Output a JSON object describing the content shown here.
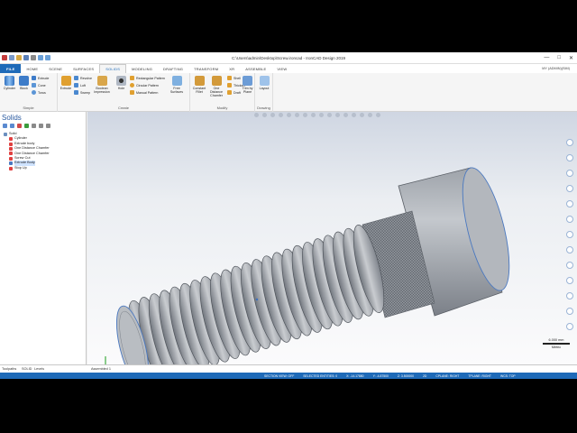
{
  "window": {
    "title": "C:\\Users\\admin\\Desktop\\Screw.ironcad - IronCAD Design 2019",
    "min": "—",
    "max": "□",
    "close": "✕"
  },
  "tabs": [
    {
      "label": "FILE",
      "kind": "file"
    },
    {
      "label": "HOME",
      "kind": ""
    },
    {
      "label": "SCENE",
      "kind": ""
    },
    {
      "label": "SURFACES",
      "kind": ""
    },
    {
      "label": "SOLIDS",
      "kind": "active"
    },
    {
      "label": "MODELING",
      "kind": ""
    },
    {
      "label": "DRAFTING",
      "kind": ""
    },
    {
      "label": "TRANSFORM",
      "kind": ""
    },
    {
      "label": "XR",
      "kind": ""
    },
    {
      "label": "ASSEMBLE",
      "kind": ""
    },
    {
      "label": "VIEW",
      "kind": ""
    }
  ],
  "user": "MY (ADMIN)(SIM)",
  "ribbon": {
    "groups": {
      "simple": "Simple",
      "create": "Create",
      "modify": "Modify",
      "drawing": "Drawing"
    },
    "buttons": {
      "cylinder": "Cylinder",
      "block": "Block",
      "extrude": "Extrude",
      "cone": "Cone",
      "torus": "Torus",
      "extrude2": "Extrude",
      "revolve": "Revolve",
      "loft": "Loft",
      "sweep": "Sweep",
      "boolean": "Boolean Impression",
      "hole": "Hole",
      "rect_pattern": "Rectangular Pattern",
      "circ_pattern": "Circular Pattern",
      "manual_pattern": "Manual Pattern",
      "free_surfaces": "Free Surfaces",
      "constant_fillet": "Constant Fillet",
      "one_distance_chamfer": "One Distance Chamfer",
      "shell": "Shell",
      "thicken": "Thicken",
      "draft": "Draft",
      "trim_by_plane": "Trim by Plane",
      "layout": "Layout"
    }
  },
  "panel": {
    "title": "Solids",
    "tree": [
      {
        "label": "Solid",
        "indent": 0,
        "color": "#6b8fbf",
        "selected": false
      },
      {
        "label": "Cylinder",
        "indent": 1,
        "color": "#e04040",
        "selected": false
      },
      {
        "label": "Extrude body",
        "indent": 1,
        "color": "#e04040",
        "selected": false
      },
      {
        "label": "One Distance Chamfer",
        "indent": 1,
        "color": "#e04040",
        "selected": false
      },
      {
        "label": "One Distance Chamfer",
        "indent": 1,
        "color": "#e04040",
        "selected": false
      },
      {
        "label": "Screw Cut",
        "indent": 1,
        "color": "#e04040",
        "selected": false
      },
      {
        "label": "Extrude Body",
        "indent": 1,
        "color": "#4a78c0",
        "selected": true
      },
      {
        "label": "Stop Up",
        "indent": 1,
        "color": "#e04040",
        "selected": false
      }
    ]
  },
  "scale": {
    "value": "6.000 mm",
    "unit": "Metric"
  },
  "docbar": {
    "tab1": "Toolpaths",
    "tab2": "SOLID",
    "tab3": "Levels",
    "doc": "Assembled 1"
  },
  "status": [
    "SECTION VIEW: OFF",
    "SELECTED ENTITIES: 0",
    "X: -14.17880",
    "Y: -4.87500",
    "Z: 3.500000",
    "2D",
    "CPLANE: RIGHT",
    "TPLANE: RIGHT",
    "WCS: TOP"
  ],
  "colors": {
    "accent": "#1e6ab8",
    "status_bar": "#1e6ab8"
  }
}
